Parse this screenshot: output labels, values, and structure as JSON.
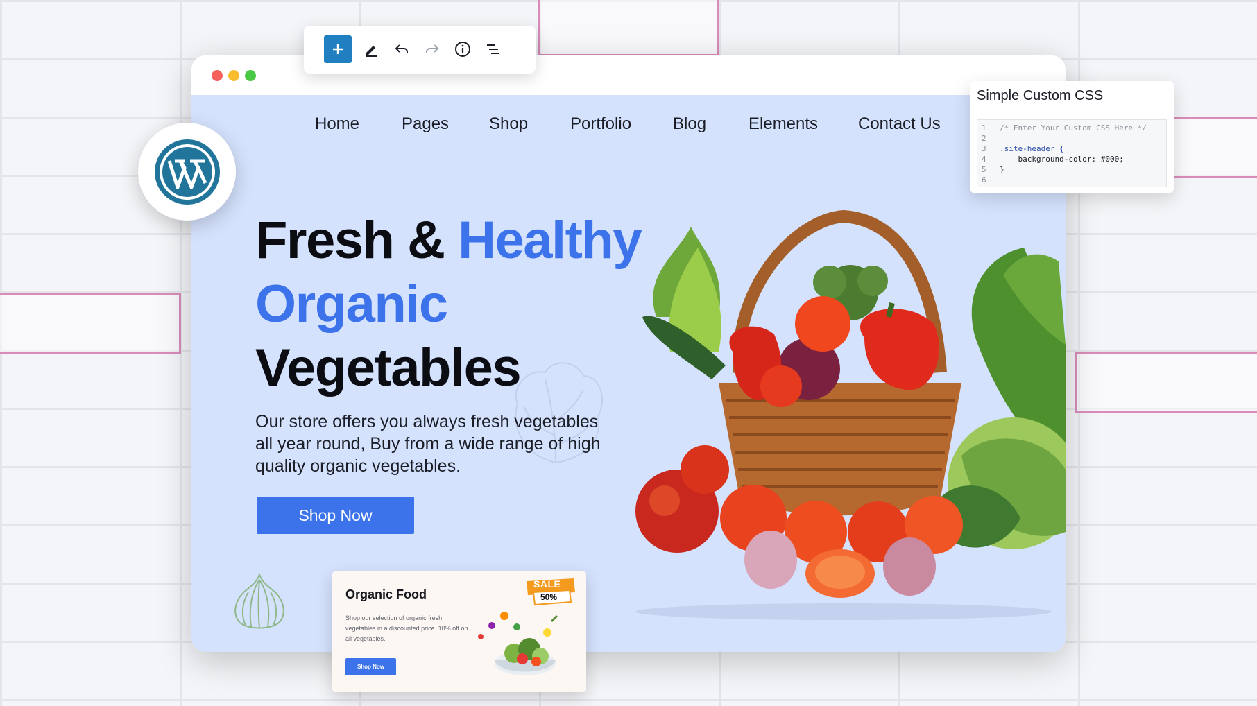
{
  "nav": {
    "items": [
      "Home",
      "Pages",
      "Shop",
      "Portfolio",
      "Blog",
      "Elements",
      "Contact Us"
    ]
  },
  "hero": {
    "headline_part1": "Fresh & ",
    "headline_part2": "Healthy",
    "headline_line2": "Organic",
    "headline_line3": "Vegetables",
    "description": "Our store offers you always fresh vegetables all year round,  Buy from a  wide range of high quality organic vegetables.",
    "button_label": "Shop Now"
  },
  "toolbar": {
    "icons": [
      "add-block-icon",
      "pencil-icon",
      "undo-icon",
      "redo-icon",
      "info-icon",
      "list-view-icon"
    ]
  },
  "css_panel": {
    "title": "Simple Custom CSS",
    "lines": [
      {
        "num": "1",
        "text": "/* Enter Your Custom CSS Here */"
      },
      {
        "num": "2",
        "text": ""
      },
      {
        "num": "3",
        "text": ".site-header {"
      },
      {
        "num": "4",
        "text": "    background-color: #000;"
      },
      {
        "num": "5",
        "text": "}"
      },
      {
        "num": "6",
        "text": ""
      }
    ]
  },
  "promo_card": {
    "title": "Organic Food",
    "description": "Shop our selection of organic fresh vegetables in a discounted price. 10% off on all vegetables.",
    "button_label": "Shop Now",
    "sale_label": "SALE",
    "sale_percent": "50%"
  },
  "colors": {
    "accent": "#3c73ea",
    "hero_background": "#d5e2fd",
    "wordpress_blue": "#21759b",
    "sale_orange": "#f39a1f"
  }
}
